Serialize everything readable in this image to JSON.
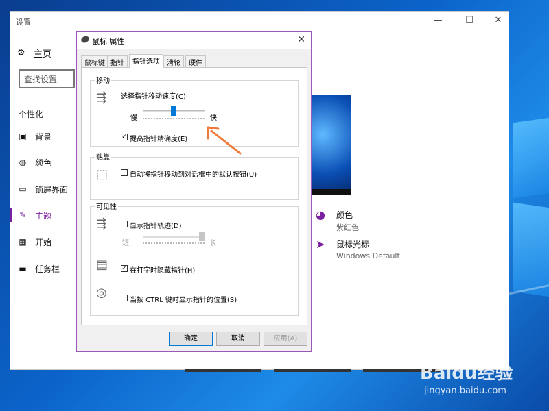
{
  "settings": {
    "title": "设置",
    "home": "主页",
    "search_placeholder": "查找设置",
    "section": "个性化",
    "nav": [
      "背景",
      "颜色",
      "锁屏界面",
      "主题",
      "开始",
      "任务栏"
    ],
    "items": [
      {
        "title": "颜色",
        "subtitle": "紫红色"
      },
      {
        "title": "鼠标光标",
        "subtitle": "Windows Default"
      }
    ],
    "accent_color": "#7a1fa0"
  },
  "dialog": {
    "title": "鼠标 属性",
    "tabs": [
      "鼠标键",
      "指针",
      "指针选项",
      "滑轮",
      "硬件"
    ],
    "active_tab": "指针选项",
    "motion": {
      "group": "移动",
      "speed_label": "选择指针移动速度(C):",
      "slow": "慢",
      "fast": "快",
      "speed_level": 0.5,
      "precision_label": "提高指针精确度(E)",
      "precision_checked": true
    },
    "snap": {
      "group": "贴靠",
      "label": "自动将指针移动到对话框中的默认按钮(U)",
      "checked": false
    },
    "visibility": {
      "group": "可见性",
      "trails_label": "显示指针轨迹(D)",
      "trails_checked": false,
      "short": "短",
      "long": "长",
      "trails_level": 1.0,
      "hide_label": "在打字时隐藏指针(H)",
      "hide_checked": true,
      "ctrl_label": "当按 CTRL 键时显示指针的位置(S)",
      "ctrl_checked": false
    },
    "buttons": {
      "ok": "确定",
      "cancel": "取消",
      "apply": "应用(A)"
    }
  },
  "watermark": {
    "brand": "Baidu经验",
    "url": "jingyan.baidu.com"
  }
}
